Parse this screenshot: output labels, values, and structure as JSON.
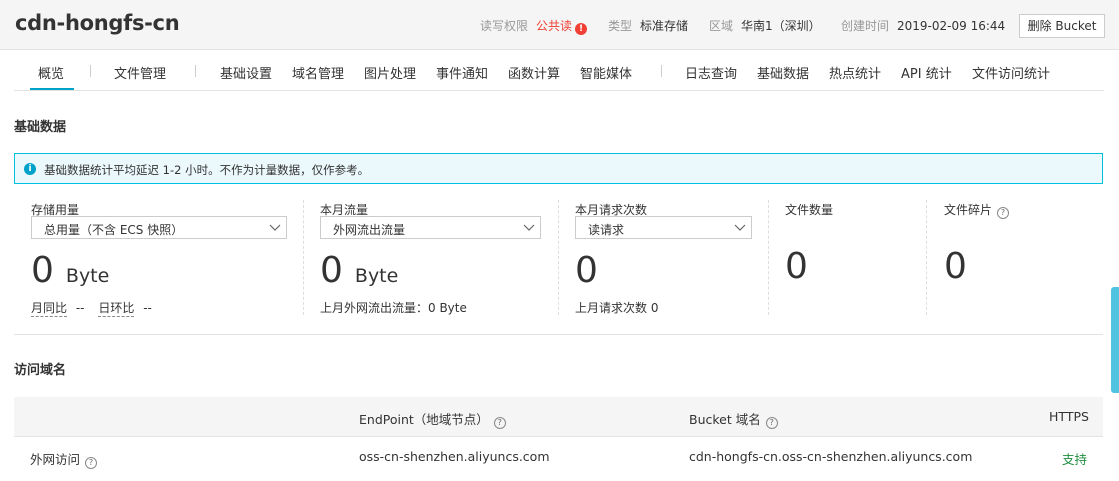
{
  "header": {
    "bucket_name": "cdn-hongfs-cn",
    "acl_label": "读写权限",
    "acl_value": "公共读",
    "acl_warn_glyph": "!",
    "type_label": "类型",
    "type_value": "标准存储",
    "region_label": "区域",
    "region_value": "华南1（深圳）",
    "created_label": "创建时间",
    "created_value": "2019-02-09 16:44",
    "delete_button": "删除 Bucket"
  },
  "tabs": [
    {
      "label": "概览",
      "active": true
    },
    {
      "label": "文件管理"
    },
    {
      "label": "基础设置"
    },
    {
      "label": "域名管理"
    },
    {
      "label": "图片处理"
    },
    {
      "label": "事件通知"
    },
    {
      "label": "函数计算"
    },
    {
      "label": "智能媒体"
    },
    {
      "label": "日志查询"
    },
    {
      "label": "基础数据"
    },
    {
      "label": "热点统计"
    },
    {
      "label": "API 统计"
    },
    {
      "label": "文件访问统计"
    }
  ],
  "basic_data": {
    "title": "基础数据",
    "notice": "基础数据统计平均延迟 1-2 小时。不作为计量数据，仅作参考。",
    "info_glyph": "i",
    "stats": {
      "storage": {
        "label": "存储用量",
        "select": "总用量（不含 ECS 快照）",
        "value": "0",
        "unit": "Byte",
        "mom_label": "月同比",
        "mom_value": "--",
        "dod_label": "日环比",
        "dod_value": "--"
      },
      "traffic": {
        "label": "本月流量",
        "select": "外网流出流量",
        "value": "0",
        "unit": "Byte",
        "last_month": "上月外网流出流量：0 Byte"
      },
      "requests": {
        "label": "本月请求次数",
        "select": "读请求",
        "value": "0",
        "last_month": "上月请求次数  0"
      },
      "file_count": {
        "label": "文件数量",
        "value": "0"
      },
      "fragments": {
        "label": "文件碎片",
        "value": "0"
      }
    }
  },
  "access": {
    "title": "访问域名",
    "help_glyph": "?",
    "columns": {
      "endpoint": "EndPoint（地域节点）",
      "bucket_domain": "Bucket 域名",
      "https": "HTTPS"
    },
    "rows": [
      {
        "name": "外网访问",
        "endpoint": "oss-cn-shenzhen.aliyuncs.com",
        "bucket_domain": "cdn-hongfs-cn.oss-cn-shenzhen.aliyuncs.com",
        "https": "支持"
      }
    ]
  }
}
